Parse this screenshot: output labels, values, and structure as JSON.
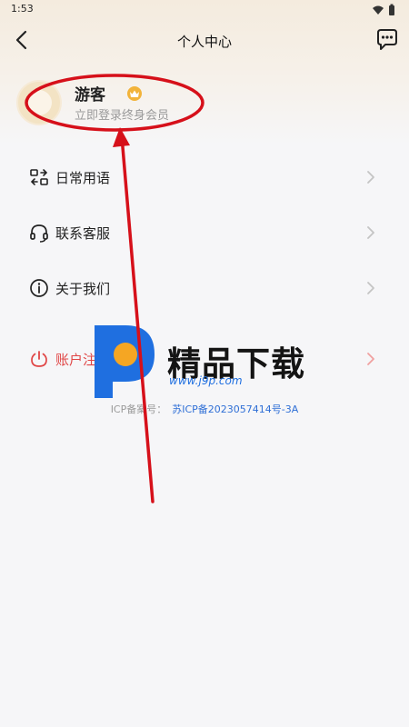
{
  "status_bar": {
    "time": "1:53",
    "icons": [
      "wifi-icon",
      "battery-icon"
    ]
  },
  "nav": {
    "title": "个人中心",
    "back_icon": "chevron-left-icon",
    "message_icon": "chat-bubble-icon"
  },
  "profile": {
    "name": "游客",
    "subtitle": "立即登录终身会员",
    "badge_icon": "crown-icon",
    "badge_color": "#f2b33a"
  },
  "menu": {
    "items": [
      {
        "label": "日常用语",
        "icon": "phrase-icon"
      },
      {
        "label": "联系客服",
        "icon": "headset-icon"
      },
      {
        "label": "关于我们",
        "icon": "info-icon"
      },
      {
        "label": "账户注销",
        "icon": "power-icon"
      }
    ]
  },
  "footer": {
    "icp_label": "ICP备案号：",
    "icp_number": "苏ICP备2023057414号-3A"
  },
  "watermark": {
    "title": "精品下载",
    "url": "www.j9p.com"
  },
  "colors": {
    "annotation": "#d6101a",
    "danger": "#e04545",
    "link": "#2f6fd6",
    "watermark_blue": "#1f6fe0",
    "watermark_orange": "#f5a623"
  }
}
